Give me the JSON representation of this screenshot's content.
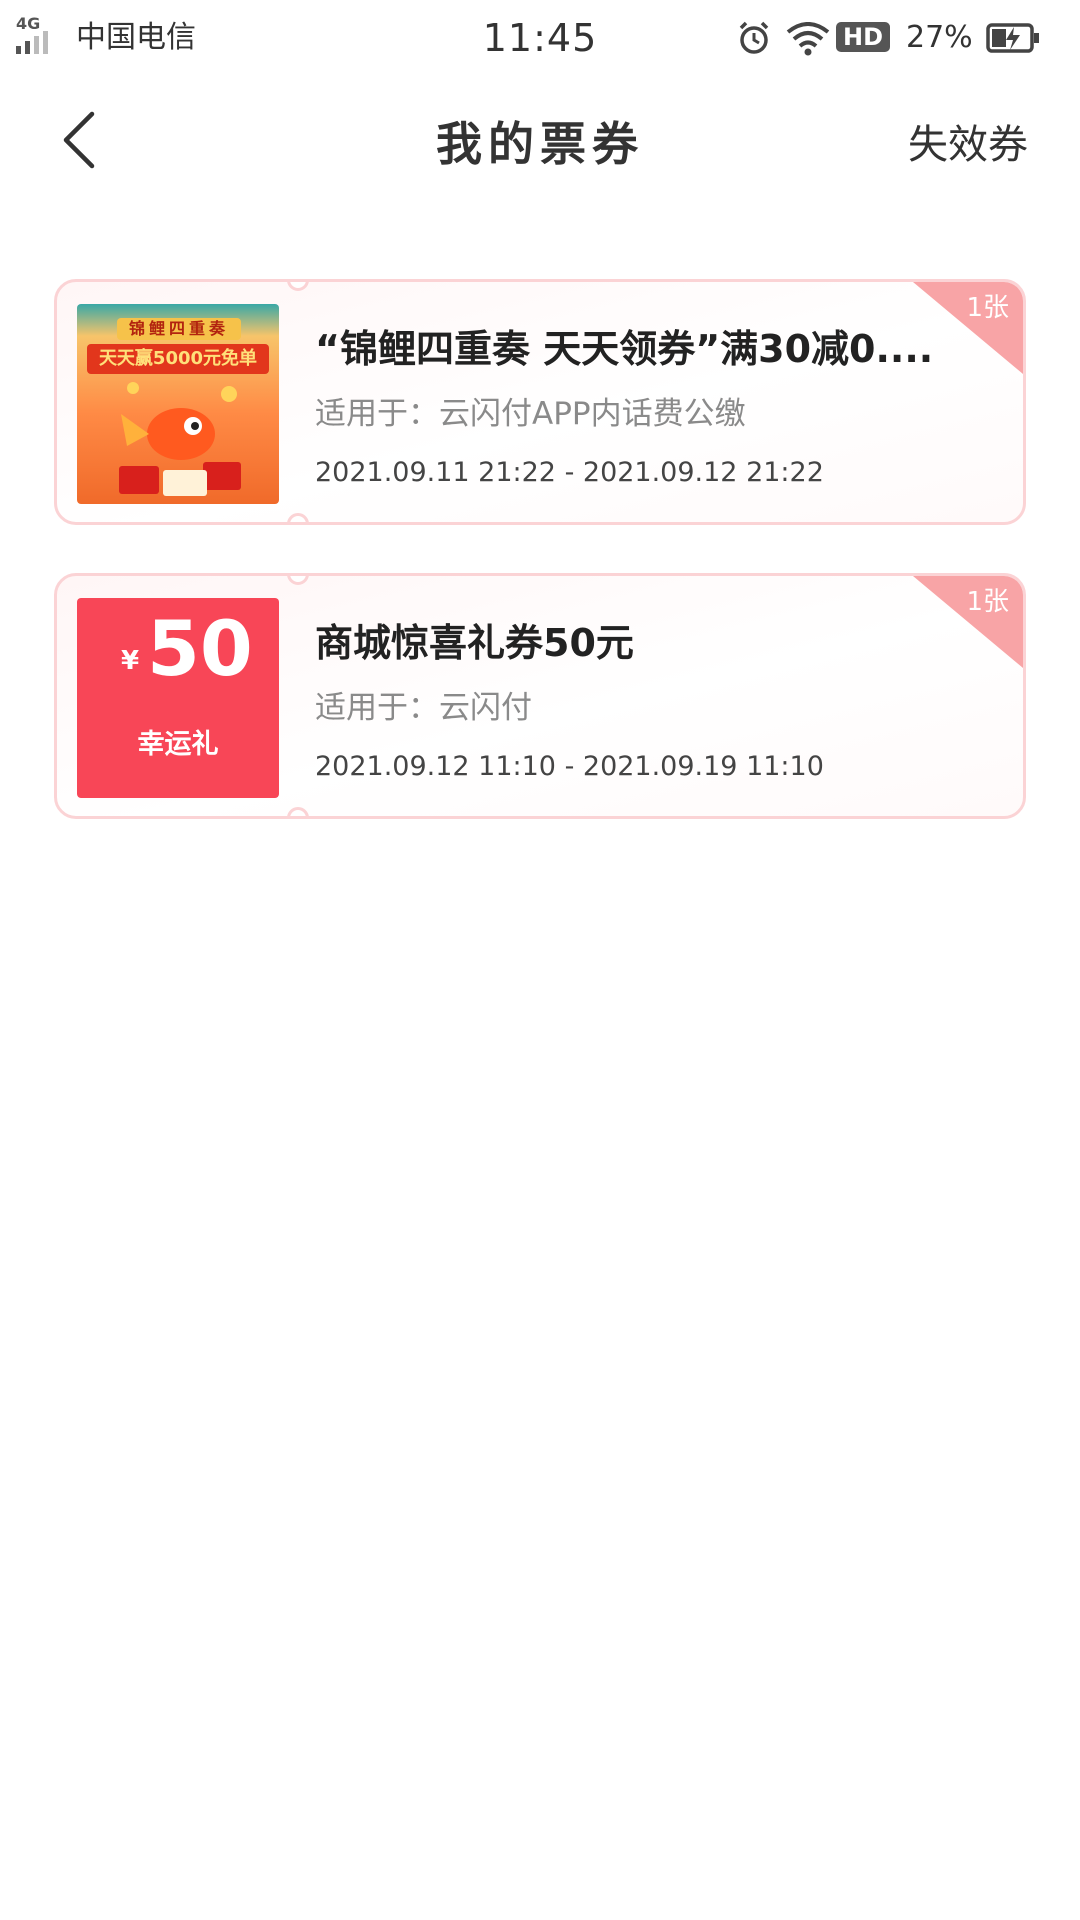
{
  "status_bar": {
    "network": "4G",
    "carrier": "中国电信",
    "time": "11:45",
    "hd": "HD",
    "battery": "27%",
    "icons": [
      "signal-icon",
      "alarm-icon",
      "wifi-icon",
      "battery-charging-icon"
    ]
  },
  "nav": {
    "title": "我的票券",
    "expired_label": "失效券",
    "back_icon": "chevron-left-icon"
  },
  "coupons": [
    {
      "title": "“锦鲤四重奏 天天领券”满30减0....",
      "scope": "适用于：云闪付APP内话费公缴",
      "date_range": "2021.09.11 21:22 - 2021.09.12 21:22",
      "count": "1张",
      "thumb": {
        "type": "poster",
        "banner_top": "锦鲤四重奏",
        "banner_main": "天天赢5000元免单"
      }
    },
    {
      "title": "商城惊喜礼券50元",
      "scope": "适用于：云闪付",
      "date_range": "2021.09.12 11:10 - 2021.09.19 11:10",
      "count": "1张",
      "thumb": {
        "type": "amount",
        "currency": "¥",
        "amount": "50",
        "label": "幸运礼"
      }
    }
  ],
  "colors": {
    "accent_red": "#f84657",
    "corner_pink": "#f8a4a6",
    "card_border": "#fbd3d5"
  }
}
